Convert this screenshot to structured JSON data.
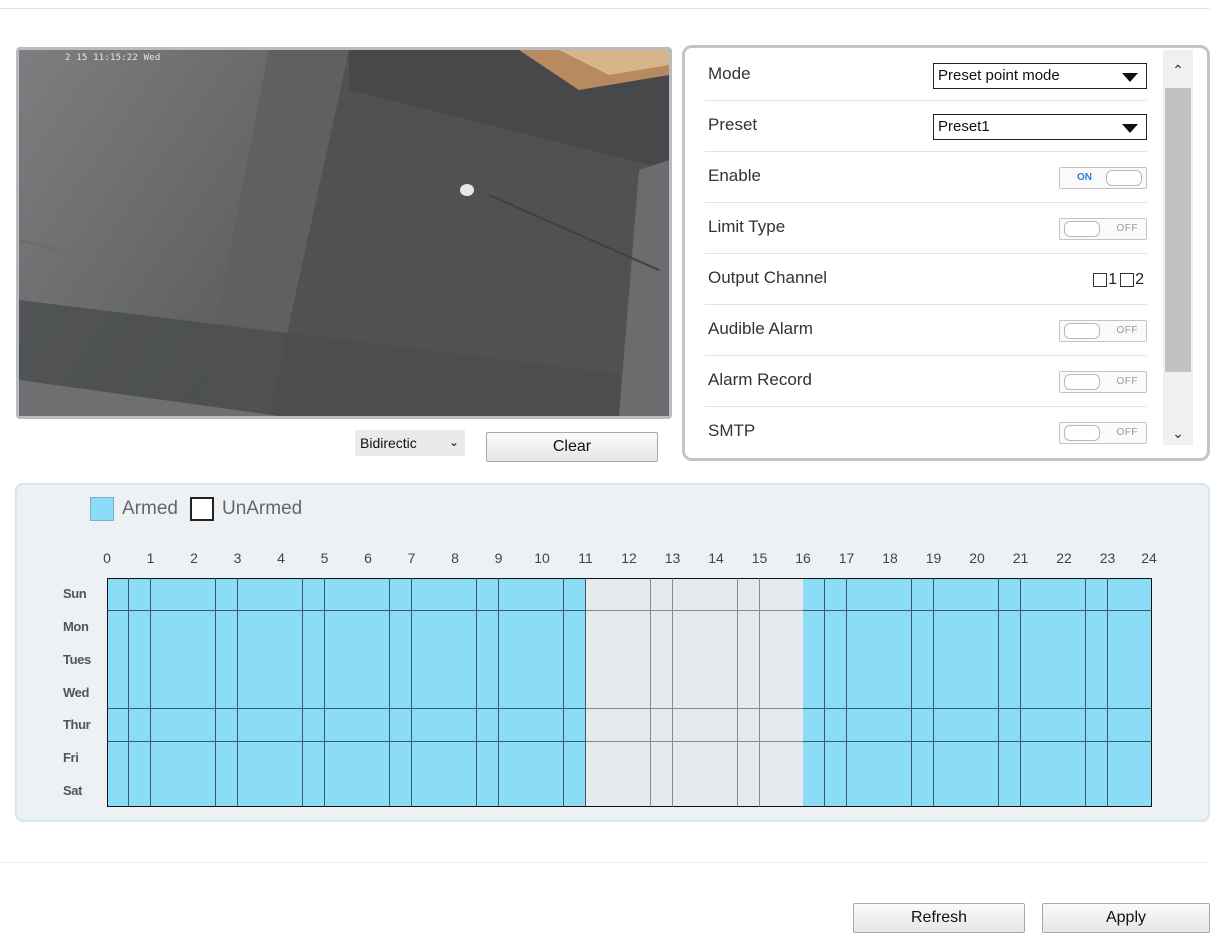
{
  "video": {
    "osd_time": "2 15 11:15:22 Wed"
  },
  "controls": {
    "direction_select": "Bidirectic",
    "clear_label": "Clear"
  },
  "settings": {
    "mode_label": "Mode",
    "mode_value": "Preset point mode",
    "preset_label": "Preset",
    "preset_value": "Preset1",
    "enable_label": "Enable",
    "enable_state": "ON",
    "limit_type_label": "Limit Type",
    "limit_type_state": "OFF",
    "output_channel_label": "Output Channel",
    "output_channel_options": [
      "1",
      "2"
    ],
    "audible_alarm_label": "Audible Alarm",
    "audible_alarm_state": "OFF",
    "alarm_record_label": "Alarm Record",
    "alarm_record_state": "OFF",
    "smtp_label": "SMTP",
    "smtp_state": "OFF"
  },
  "schedule": {
    "legend_armed": "Armed",
    "legend_unarmed": "UnArmed",
    "hours": [
      "0",
      "1",
      "2",
      "3",
      "4",
      "5",
      "6",
      "7",
      "8",
      "9",
      "10",
      "11",
      "12",
      "13",
      "14",
      "15",
      "16",
      "17",
      "18",
      "19",
      "20",
      "21",
      "22",
      "23",
      "24"
    ],
    "days": [
      "Sun",
      "Mon",
      "Tues",
      "Wed",
      "Thur",
      "Fri",
      "Sat"
    ],
    "slots_per_hour": 2,
    "unarmed_from_hour": 11,
    "unarmed_to_hour": 16,
    "armed_color": "#8bdcf7",
    "unarmed_color": "#e7eaed"
  },
  "footer": {
    "refresh_label": "Refresh",
    "apply_label": "Apply"
  }
}
